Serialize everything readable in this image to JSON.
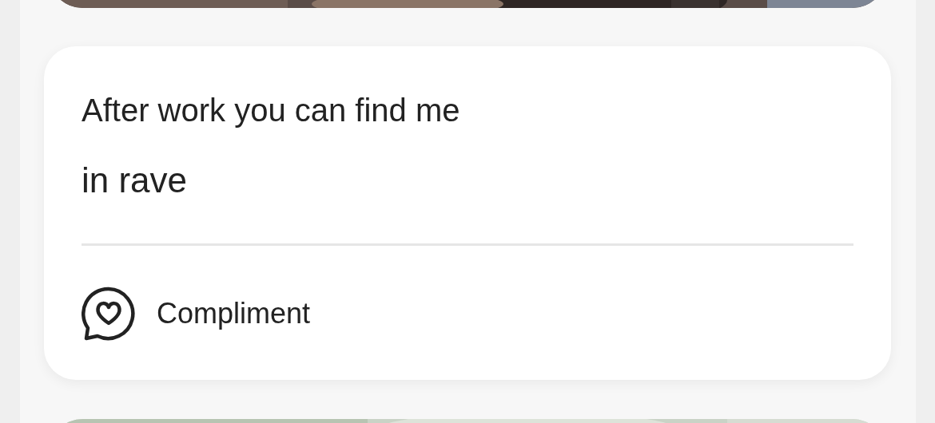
{
  "prompt": {
    "question": "After work you can find me",
    "answer": "in rave"
  },
  "action": {
    "label": "Compliment"
  }
}
